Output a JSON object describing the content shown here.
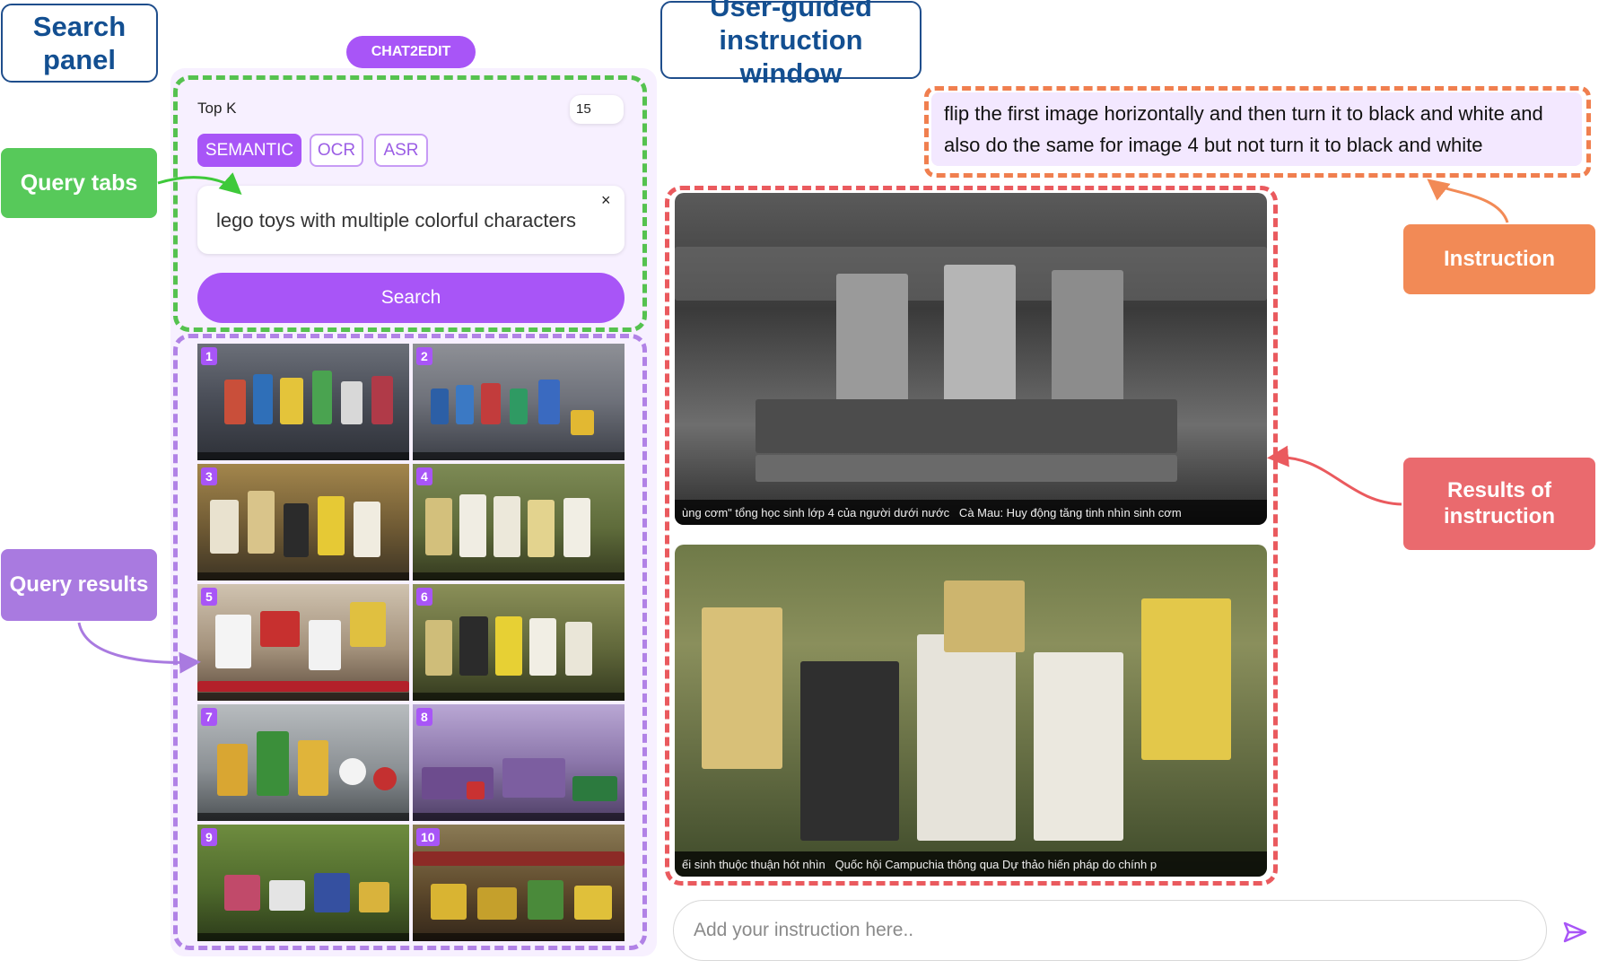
{
  "labels": {
    "search_panel": "Search panel",
    "instruction_window": "User-guided instruction window",
    "query_tabs": "Query tabs",
    "query_results": "Query results",
    "instruction": "Instruction",
    "results_of_instruction": "Results of instruction"
  },
  "app": {
    "badge": "CHAT2EDIT"
  },
  "search": {
    "topk_label": "Top K",
    "topk_value": "15",
    "tabs": [
      {
        "label": "SEMANTIC",
        "active": true
      },
      {
        "label": "OCR",
        "active": false
      },
      {
        "label": "ASR",
        "active": false
      }
    ],
    "query": "lego toys with multiple colorful characters",
    "clear_symbol": "×",
    "button_label": "Search"
  },
  "results": {
    "numbers": [
      "1",
      "2",
      "3",
      "4",
      "5",
      "6",
      "7",
      "8",
      "9",
      "10"
    ]
  },
  "chat": {
    "instruction_text": "flip the first image horizontally and then turn it to black and white and also do the same for image 4 but not turn it to black and white",
    "input_placeholder": "Add your instruction here..",
    "send_icon": "send-icon"
  },
  "colors": {
    "accent": "#a855f7",
    "green": "#55c24f",
    "orange": "#f07f4f",
    "red": "#ea5a5e",
    "blue": "#134f91"
  }
}
